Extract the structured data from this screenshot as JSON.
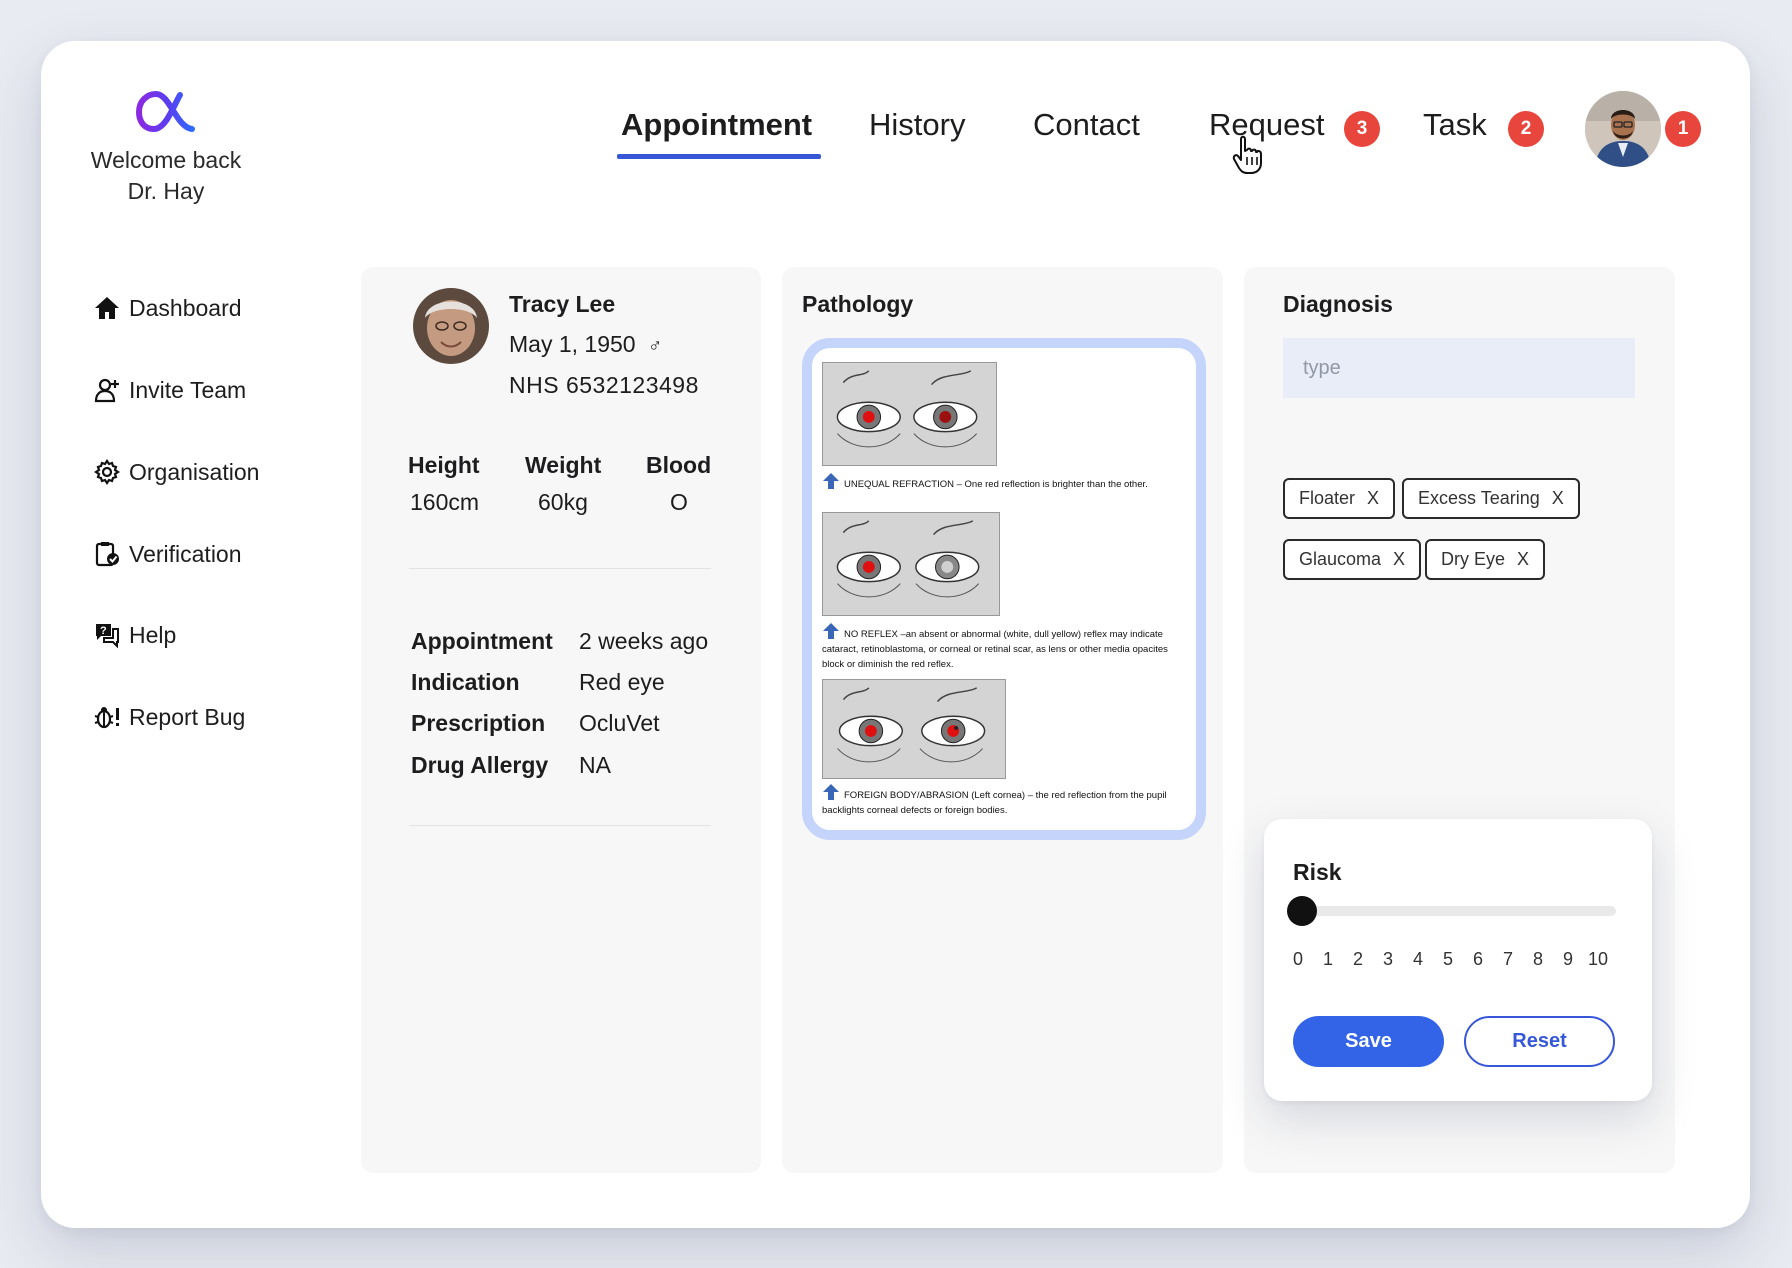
{
  "brand": {
    "welcome_line1": "Welcome back",
    "welcome_line2": "Dr. Hay",
    "accent": "#7a2ee0"
  },
  "nav": {
    "items": [
      {
        "label": "Appointment",
        "active": true
      },
      {
        "label": "History"
      },
      {
        "label": "Contact"
      },
      {
        "label": "Request",
        "badge": "3"
      },
      {
        "label": "Task",
        "badge": "2"
      }
    ],
    "avatar_badge": "1",
    "underline_color": "#3658d8",
    "badge_color": "#e8453c"
  },
  "sidebar": {
    "items": [
      {
        "label": "Dashboard",
        "icon": "home-icon"
      },
      {
        "label": "Invite Team",
        "icon": "add-user-icon"
      },
      {
        "label": "Organisation",
        "icon": "gear-icon"
      },
      {
        "label": "Verification",
        "icon": "clipboard-check-icon"
      },
      {
        "label": "Help",
        "icon": "help-chat-icon"
      },
      {
        "label": "Report Bug",
        "icon": "bug-icon"
      }
    ]
  },
  "patient": {
    "name": "Tracy Lee",
    "dob": "May 1, 1950",
    "sex_symbol": "♂",
    "nhs": "NHS 6532123498",
    "vitals": {
      "height_label": "Height",
      "height_value": "160cm",
      "weight_label": "Weight",
      "weight_value": "60kg",
      "blood_label": "Blood",
      "blood_value": "O"
    },
    "details": [
      {
        "label": "Appointment",
        "value": "2 weeks ago"
      },
      {
        "label": "Indication",
        "value": "Red eye"
      },
      {
        "label": "Prescription",
        "value": "OcluVet"
      },
      {
        "label": "Drug Allergy",
        "value": "NA"
      }
    ]
  },
  "pathology": {
    "title": "Pathology",
    "captions": [
      "UNEQUAL REFRACTION – One red reflection is brighter than the other.",
      "NO REFLEX –an absent or abnormal (white, dull yellow) reflex may indicate cataract, retinoblastoma, or corneal or retinal scar, as lens or other media opacites block or diminish the red reflex.",
      "FOREIGN BODY/ABRASION (Left cornea) – the red reflection from the pupil backlights corneal defects or foreign bodies."
    ]
  },
  "diagnosis": {
    "title": "Diagnosis",
    "placeholder": "type",
    "tags": [
      "Floater",
      "Excess Tearing",
      "Glaucoma",
      "Dry Eye"
    ],
    "remove_symbol": "X"
  },
  "risk": {
    "title": "Risk",
    "value": 0,
    "min": 0,
    "max": 10,
    "ticks": [
      "0",
      "1",
      "2",
      "3",
      "4",
      "5",
      "6",
      "7",
      "8",
      "9",
      "10"
    ],
    "save_label": "Save",
    "reset_label": "Reset",
    "primary_color": "#3364e8"
  }
}
